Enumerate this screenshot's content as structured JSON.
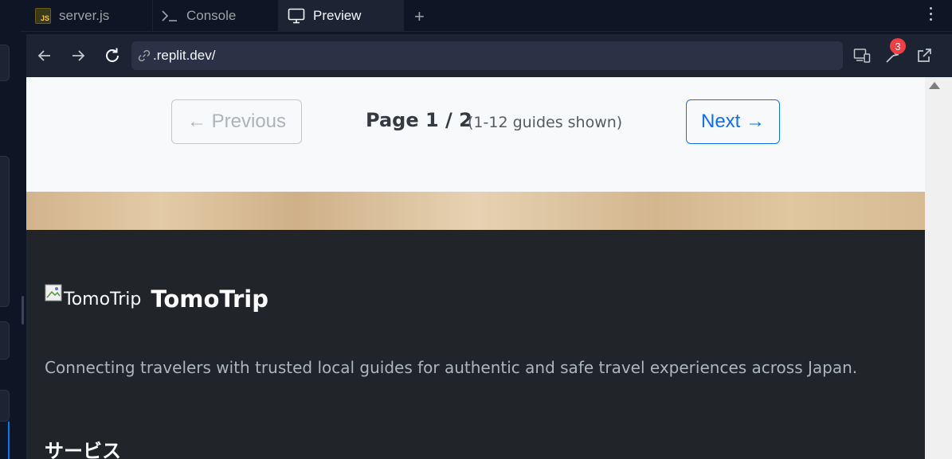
{
  "tabs": [
    {
      "label": "server.js",
      "icon": "js-file-icon",
      "active": false
    },
    {
      "label": "Console",
      "icon": "terminal-icon",
      "active": false
    },
    {
      "label": "Preview",
      "icon": "monitor-icon",
      "active": true
    }
  ],
  "tab_add_symbol": "+",
  "toolbar": {
    "url": ".replit.dev/",
    "devtools_badge": "3"
  },
  "page": {
    "previous_label": "← Previous",
    "page_indicator": "Page 1 / 2",
    "shown_count": "(1-12 guides shown)",
    "next_label": "Next →"
  },
  "footer": {
    "logo_alt": "TomoTrip",
    "brand": "TomoTrip",
    "tagline": "Connecting travelers with trusted local guides for authentic and safe travel experiences across Japan.",
    "services_heading": "サービス"
  },
  "colors": {
    "accent_blue": "#0d6efd",
    "footer_bg": "#212529",
    "badge_red": "#f23f42"
  }
}
